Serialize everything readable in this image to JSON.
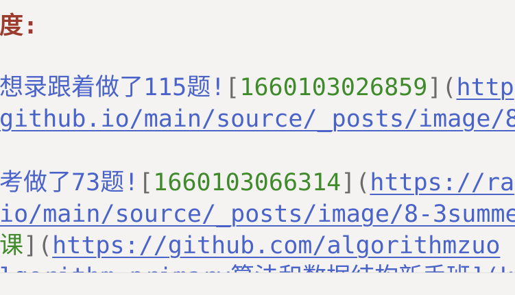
{
  "editor": {
    "heading": "度:",
    "line1": {
      "text": "想录跟着做了115题!",
      "bracket_open": "[",
      "label": "1660103026859",
      "bracket_close": "]",
      "paren_open": "(",
      "link": "http"
    },
    "line2": {
      "link": "github.io/main/source/_posts/image/8"
    },
    "line3": {
      "text": "考做了73题!",
      "bracket_open": "[",
      "label": "1660103066314",
      "bracket_close": "]",
      "paren_open": "(",
      "link": "https://ra"
    },
    "line4": {
      "link": "io/main/source/_posts/image/8-3summe"
    },
    "line5": {
      "text": "课",
      "bracket_close": "]",
      "paren_open": "(",
      "link": "https://github.com/algorithmzuo"
    },
    "line6": {
      "text": "lgorithm-primary算法和数据结构新手班](k"
    }
  },
  "colors": {
    "background": "#f4f3f2",
    "heading": "#9c3a2c",
    "text_blue": "#4a63c9",
    "label_green": "#3f8a2a"
  }
}
